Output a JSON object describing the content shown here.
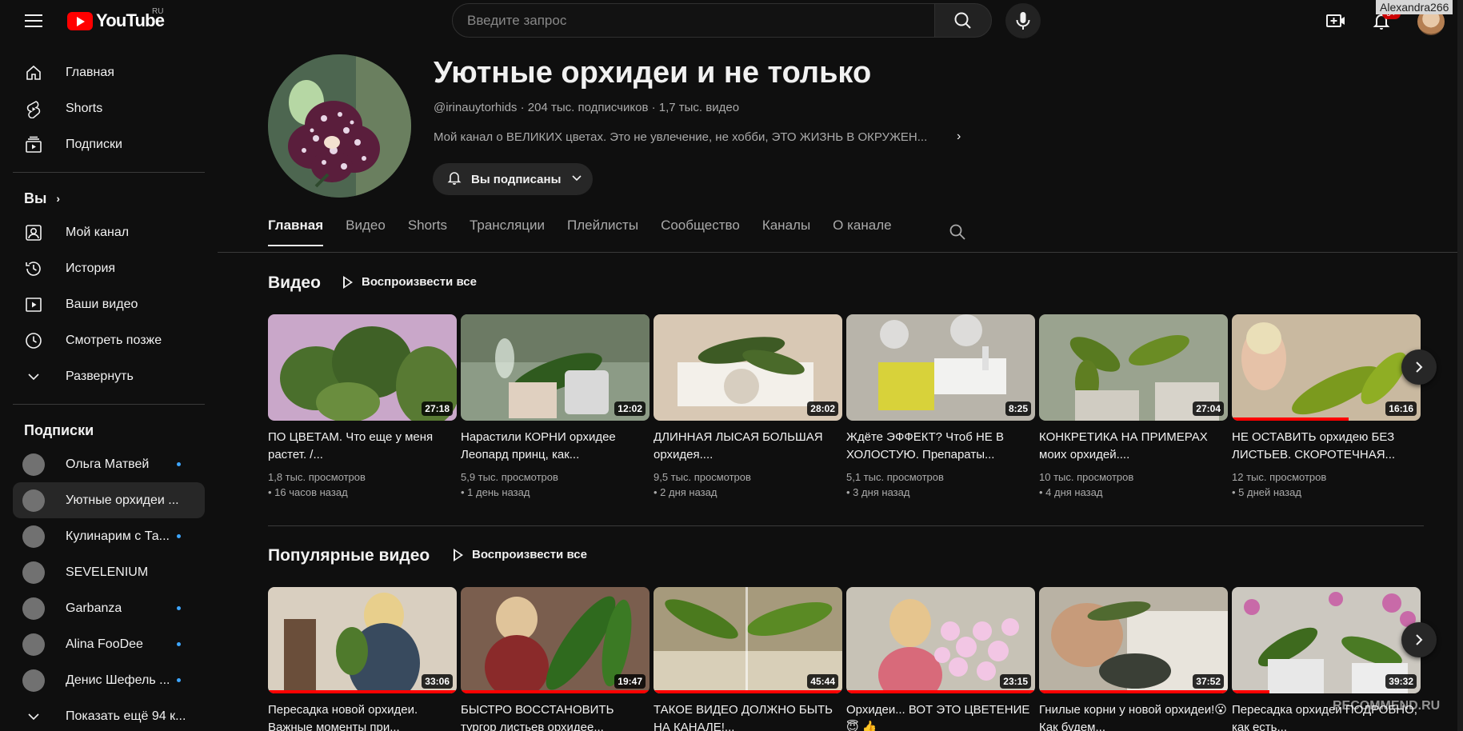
{
  "topbar": {
    "logo_text": "YouTube",
    "region": "RU",
    "search_placeholder": "Введите запрос",
    "notifications": "9+",
    "user_tag": "Alexandra266"
  },
  "sidebar": {
    "main": [
      {
        "label": "Главная",
        "icon": "home-icon"
      },
      {
        "label": "Shorts",
        "icon": "shorts-icon"
      },
      {
        "label": "Подписки",
        "icon": "subscriptions-icon"
      }
    ],
    "you_heading": "Вы",
    "you": [
      {
        "label": "Мой канал",
        "icon": "my-channel-icon"
      },
      {
        "label": "История",
        "icon": "history-icon"
      },
      {
        "label": "Ваши видео",
        "icon": "your-videos-icon"
      },
      {
        "label": "Смотреть позже",
        "icon": "watch-later-icon"
      },
      {
        "label": "Развернуть",
        "icon": "chevron-down-icon"
      }
    ],
    "subs_heading": "Подписки",
    "subs": [
      {
        "label": "Ольга Матвей",
        "dot": true
      },
      {
        "label": "Уютные орхидеи ...",
        "dot": false,
        "active": true
      },
      {
        "label": "Кулинарим с Та...",
        "dot": true
      },
      {
        "label": "SEVELENIUM",
        "dot": false
      },
      {
        "label": "Garbanza",
        "dot": true
      },
      {
        "label": "Alina FooDee",
        "dot": true
      },
      {
        "label": "Денис Шефель ...",
        "dot": true
      },
      {
        "label": "Показать ещё 94 к...",
        "dot": false
      }
    ]
  },
  "channel": {
    "title": "Уютные орхидеи и не только",
    "handle": "@irinauytorhids",
    "subscribers": "204 тыс. подписчиков",
    "videos_count": "1,7 тыс. видео",
    "description": "Мой канал о ВЕЛИКИХ цветах. Это не увлечение, не хобби, ЭТО ЖИЗНЬ В ОКРУЖЕН...",
    "subscribed_label": "Вы подписаны"
  },
  "tabs": [
    "Главная",
    "Видео",
    "Shorts",
    "Трансляции",
    "Плейлисты",
    "Сообщество",
    "Каналы",
    "О канале"
  ],
  "sections": [
    {
      "title": "Видео",
      "play_all": "Воспроизвести все",
      "videos": [
        {
          "title": "ПО ЦВЕТАМ. Что еще у меня растет. /...",
          "duration": "27:18",
          "views": "1,8 тыс. просмотров",
          "age": "• 16 часов назад",
          "progress": 0
        },
        {
          "title": "Нарастили КОРНИ орхидее Леопард принц, как...",
          "duration": "12:02",
          "views": "5,9 тыс. просмотров",
          "age": "• 1 день назад",
          "progress": 0
        },
        {
          "title": "ДЛИННАЯ ЛЫСАЯ БОЛЬШАЯ орхидея....",
          "duration": "28:02",
          "views": "9,5 тыс. просмотров",
          "age": "• 2 дня назад",
          "progress": 0
        },
        {
          "title": "Ждёте ЭФФЕКТ? Чтоб НЕ В ХОЛОСТУЮ. Препараты...",
          "duration": "8:25",
          "views": "5,1 тыс. просмотров",
          "age": "• 3 дня назад",
          "progress": 0
        },
        {
          "title": "КОНКРЕТИКА НА ПРИМЕРАХ моих орхидей....",
          "duration": "27:04",
          "views": "10 тыс. просмотров",
          "age": "• 4 дня назад",
          "progress": 0
        },
        {
          "title": "НЕ ОСТАВИТЬ орхидею БЕЗ ЛИСТЬЕВ. СКОРОТЕЧНАЯ...",
          "duration": "16:16",
          "views": "12 тыс. просмотров",
          "age": "• 5 дней назад",
          "progress": 0.62
        }
      ]
    },
    {
      "title": "Популярные видео",
      "play_all": "Воспроизвести все",
      "videos": [
        {
          "title": "Пересадка новой орхидеи. Важные моменты при...",
          "duration": "33:06",
          "progress": 1
        },
        {
          "title": "БЫСТРО ВОССТАНОВИТЬ тургор листьев орхидее...",
          "duration": "19:47",
          "progress": 1
        },
        {
          "title": "ТАКОЕ ВИДЕО ДОЛЖНО БЫТЬ НА КАНАЛЕ!...",
          "duration": "45:44",
          "progress": 1
        },
        {
          "title": "Орхидеи... ВОТ ЭТО ЦВЕТЕНИЕ 😇 👍",
          "duration": "23:15",
          "progress": 1
        },
        {
          "title": "Гнилые корни у новой орхидеи!😮 Как будем...",
          "duration": "37:52",
          "progress": 1
        },
        {
          "title": "Пересадка орхидеи ПОДРОБНО, как есть...",
          "duration": "39:32",
          "progress": 0.2
        }
      ]
    }
  ],
  "watermark": "RECOMMEND.RU",
  "colors": {
    "background": "#0f0f0f",
    "accent": "#ff0000",
    "link": "#3ea6ff"
  }
}
